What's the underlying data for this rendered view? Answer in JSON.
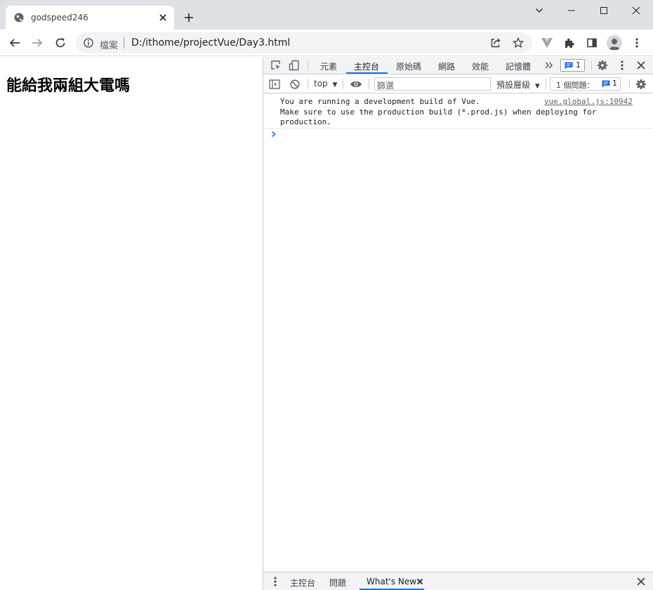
{
  "browser": {
    "tab_title": "godspeed246",
    "address_label": "檔案",
    "address_url": "D:/ithome/projectVue/Day3.html"
  },
  "page": {
    "heading": "能給我兩組大電嗎"
  },
  "devtools": {
    "tabs": [
      "元素",
      "主控台",
      "原始碼",
      "網路",
      "效能",
      "記憶體"
    ],
    "active_tab": "主控台",
    "issues_badge_count": "1",
    "context": "top",
    "filter_placeholder": "篩選",
    "levels_label": "預設層級",
    "issues_label": "1 個問題：",
    "issues_count": "1",
    "console_message": "You are running a development build of Vue.\nMake sure to use the production build (*.prod.js) when deploying for\nproduction.",
    "console_source": "vue.global.js:10942",
    "drawer_tabs": [
      "主控台",
      "問題",
      "What's New"
    ]
  },
  "colors": {
    "accent": "#1a73e8",
    "chrome_frame": "#dee1e6"
  }
}
